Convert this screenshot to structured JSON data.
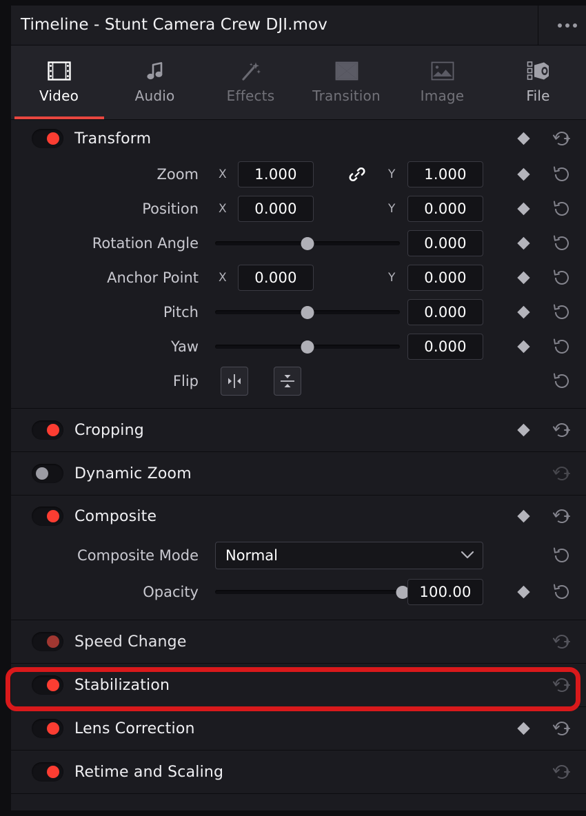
{
  "window": {
    "title": "Timeline - Stunt Camera Crew DJI.mov",
    "overflow_menu": "more-options"
  },
  "tabs": [
    {
      "label": "Video",
      "icon": "film-strip-icon",
      "state": "active"
    },
    {
      "label": "Audio",
      "icon": "music-note-icon",
      "state": "enabled"
    },
    {
      "label": "Effects",
      "icon": "magic-wand-icon",
      "state": "disabled"
    },
    {
      "label": "Transition",
      "icon": "transition-icon",
      "state": "disabled"
    },
    {
      "label": "Image",
      "icon": "image-icon",
      "state": "disabled"
    },
    {
      "label": "File",
      "icon": "file-clip-icon",
      "state": "enabled"
    }
  ],
  "sections": {
    "transform": {
      "title": "Transform",
      "enabled": true,
      "rows": {
        "zoom": {
          "label": "Zoom",
          "x_axis": "X",
          "y_axis": "Y",
          "x": "1.000",
          "y": "1.000",
          "link": "linked"
        },
        "position": {
          "label": "Position",
          "x_axis": "X",
          "y_axis": "Y",
          "x": "0.000",
          "y": "0.000"
        },
        "rotation": {
          "label": "Rotation Angle",
          "value": "0.000",
          "slider_percent": 50
        },
        "anchor_point": {
          "label": "Anchor Point",
          "x_axis": "X",
          "y_axis": "Y",
          "x": "0.000",
          "y": "0.000"
        },
        "pitch": {
          "label": "Pitch",
          "value": "0.000",
          "slider_percent": 50
        },
        "yaw": {
          "label": "Yaw",
          "value": "0.000",
          "slider_percent": 50
        },
        "flip": {
          "label": "Flip",
          "horizontal_icon": "flip-horizontal-icon",
          "vertical_icon": "flip-vertical-icon"
        }
      }
    },
    "cropping": {
      "title": "Cropping",
      "enabled": true
    },
    "dynamic_zoom": {
      "title": "Dynamic Zoom",
      "enabled": false
    },
    "composite": {
      "title": "Composite",
      "enabled": true,
      "rows": {
        "composite_mode": {
          "label": "Composite Mode",
          "value": "Normal"
        },
        "opacity": {
          "label": "Opacity",
          "value": "100.00",
          "slider_percent": 100
        }
      }
    },
    "speed_change": {
      "title": "Speed Change",
      "enabled": true,
      "dimmed": true
    },
    "stabilization": {
      "title": "Stabilization",
      "enabled": true,
      "highlighted": true
    },
    "lens_correction": {
      "title": "Lens Correction",
      "enabled": true
    },
    "retime_and_scaling": {
      "title": "Retime and Scaling",
      "enabled": true
    }
  },
  "colors": {
    "accent_red": "#fc3d32",
    "tab_underline": "#e8463f",
    "annotation_red": "#d9191b",
    "panel_bg": "#1b1b20",
    "header_bg": "#1d1d22"
  }
}
